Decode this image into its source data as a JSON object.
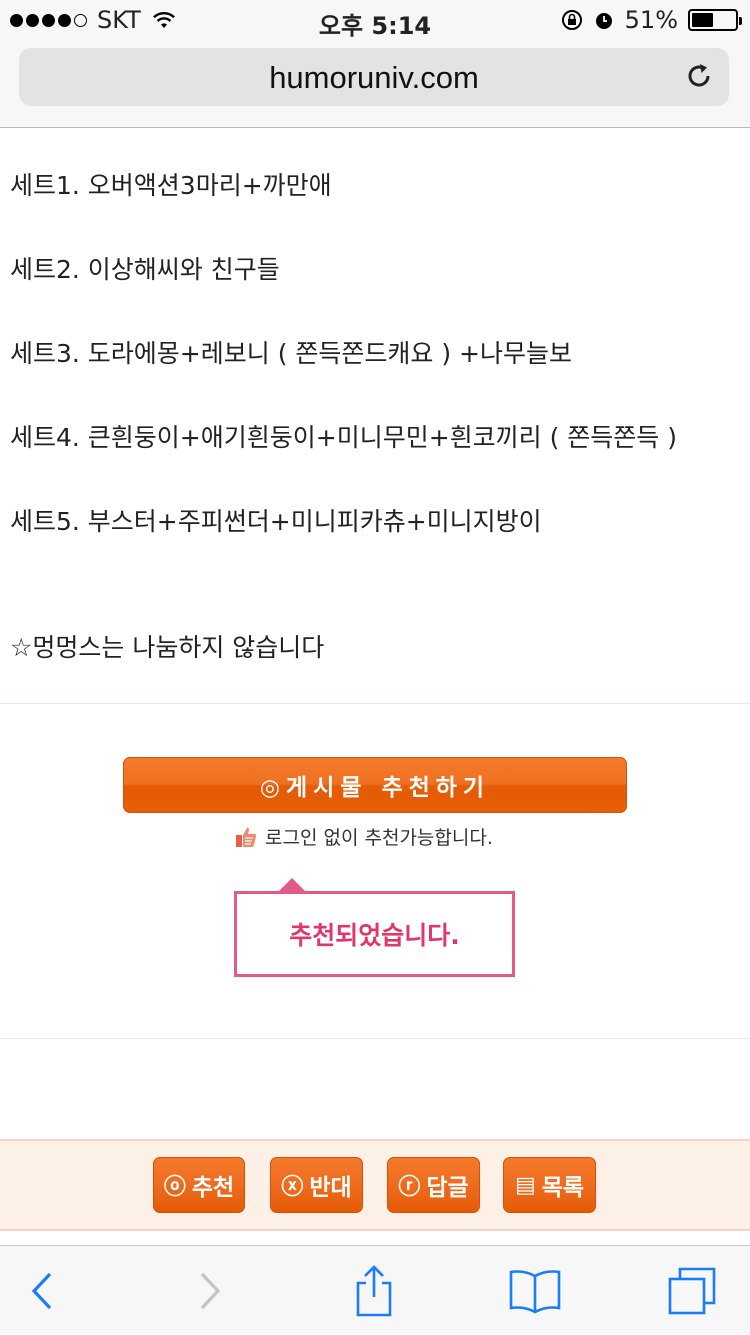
{
  "status_bar": {
    "carrier": "SKT",
    "time": "오후 5:14",
    "battery_percent": "51%",
    "battery_level": 0.51
  },
  "address_bar": {
    "url": "humoruniv.com"
  },
  "content": {
    "lines": [
      "세트1. 오버액션3마리+까만애",
      "세트2. 이상해씨와 친구들",
      "세트3. 도라에몽+레보니 ( 쫀득쫀드캐요 ) +나무늘보",
      "세트4. 큰흰둥이+애기흰둥이+미니무민+흰코끼리 ( 쫀득쫀득 )",
      "세트5. 부스터+주피썬더+미니피카츄+미니지방이",
      "☆멍멍스는 나눔하지 않습니다"
    ]
  },
  "recommend": {
    "button_label": "◎게시물 추천하기",
    "note": "로그인 없이 추천가능합니다.",
    "tooltip": "추천되었습니다."
  },
  "actions": {
    "recommend": {
      "icon": "ⓞ",
      "label": "추천"
    },
    "oppose": {
      "icon": "ⓧ",
      "label": "반대"
    },
    "reply": {
      "icon": "ⓡ",
      "label": "답글"
    },
    "list": {
      "icon": "▤",
      "label": "목록"
    }
  },
  "toolbar": {
    "icons": [
      "back-icon",
      "forward-icon",
      "share-icon",
      "bookmarks-icon",
      "tabs-icon"
    ],
    "accent": "#1a7cfa"
  }
}
